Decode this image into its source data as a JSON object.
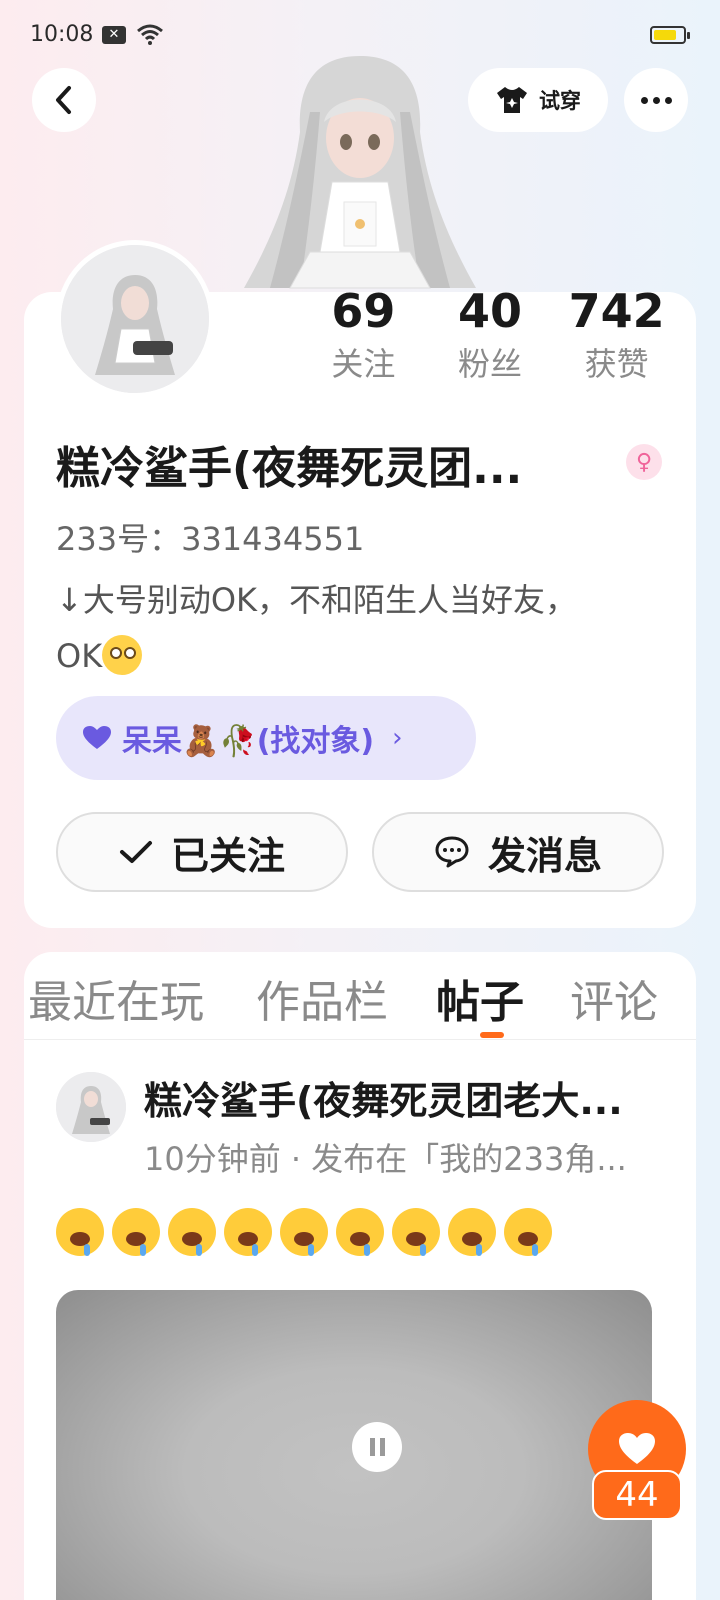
{
  "status_bar": {
    "time": "10:08",
    "notification_icon": "x-box-icon",
    "wifi_icon": "wifi-icon",
    "battery_level": 0.8
  },
  "header": {
    "back_icon": "chevron-left-icon",
    "try_on_label": "试穿",
    "try_on_icon": "shirt-icon",
    "more_icon": "more-dots-icon"
  },
  "profile": {
    "stats": [
      {
        "value": "69",
        "label": "关注"
      },
      {
        "value": "40",
        "label": "粉丝"
      },
      {
        "value": "742",
        "label": "获赞"
      }
    ],
    "name": "糕冷鲨手(夜舞死灵团...",
    "gender_icon": "female-icon",
    "user_id": "233号：331434551",
    "bio": "↓大号别动OK，不和陌生人当好友，OK",
    "tag": {
      "label": "呆呆🧸🥀(找对象)",
      "icon": "heart-icon"
    },
    "follow_label": "已关注",
    "message_label": "发消息"
  },
  "tabs": [
    {
      "label": "最近在玩",
      "active": false
    },
    {
      "label": "作品栏",
      "active": false
    },
    {
      "label": "帖子",
      "active": true
    },
    {
      "label": "评论",
      "active": false
    }
  ],
  "post": {
    "author": "糕冷鲨手(夜舞死灵团老大...",
    "meta": "10分钟前 · 发布在「我的233角...",
    "emoji_count": 9,
    "emoji_icon": "drooling-face-icon"
  },
  "like": {
    "count": "44"
  },
  "colors": {
    "accent": "#ff6a1a",
    "tag_bg": "#e8e6fb",
    "tag_text": "#6a5ae0",
    "gender": "#f0649a"
  }
}
